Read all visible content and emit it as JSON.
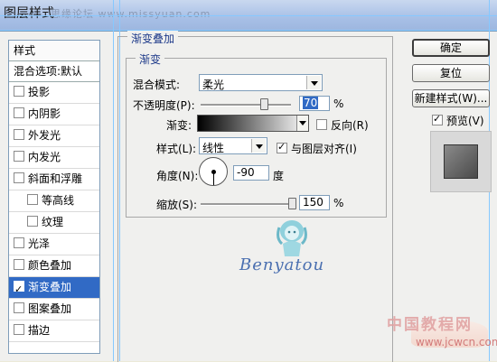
{
  "window": {
    "title": "图层样式",
    "watermark": "思缘论坛 www.missyuan.com"
  },
  "left_panel": {
    "header": "样式",
    "blend_options": "混合选项:默认",
    "items": [
      {
        "label": "投影",
        "checked": false,
        "sub": false
      },
      {
        "label": "内阴影",
        "checked": false,
        "sub": false
      },
      {
        "label": "外发光",
        "checked": false,
        "sub": false
      },
      {
        "label": "内发光",
        "checked": false,
        "sub": false
      },
      {
        "label": "斜面和浮雕",
        "checked": false,
        "sub": false
      },
      {
        "label": "等高线",
        "checked": false,
        "sub": true
      },
      {
        "label": "纹理",
        "checked": false,
        "sub": true
      },
      {
        "label": "光泽",
        "checked": false,
        "sub": false
      },
      {
        "label": "颜色叠加",
        "checked": false,
        "sub": false
      },
      {
        "label": "渐变叠加",
        "checked": true,
        "sub": false,
        "selected": true
      },
      {
        "label": "图案叠加",
        "checked": false,
        "sub": false
      },
      {
        "label": "描边",
        "checked": false,
        "sub": false
      }
    ]
  },
  "gradient_overlay": {
    "group_title": "渐变叠加",
    "sub_title": "渐变",
    "blend_mode_label": "混合模式:",
    "blend_mode_value": "柔光",
    "opacity_label": "不透明度(P):",
    "opacity_value": "70",
    "opacity_fraction": 0.7,
    "opacity_unit": "%",
    "gradient_label": "渐变:",
    "reverse_label": "反向(R)",
    "style_label": "样式(L):",
    "style_value": "线性",
    "align_label": "与图层对齐(I)",
    "angle_label": "角度(N):",
    "angle_value": "-90",
    "angle_unit": "度",
    "scale_label": "缩放(S):",
    "scale_value": "150",
    "scale_fraction": 1.0,
    "scale_unit": "%"
  },
  "buttons": {
    "ok": "确定",
    "reset": "复位",
    "new_style": "新建样式(W)...",
    "preview": "预览(V)"
  },
  "watermarks": {
    "brand": "Benyatou",
    "site_cn": "中国教程网",
    "site_url": "www.jcwcn.com"
  },
  "colors": {
    "selection": "#316ac5",
    "group_title": "#1e3a8a"
  }
}
